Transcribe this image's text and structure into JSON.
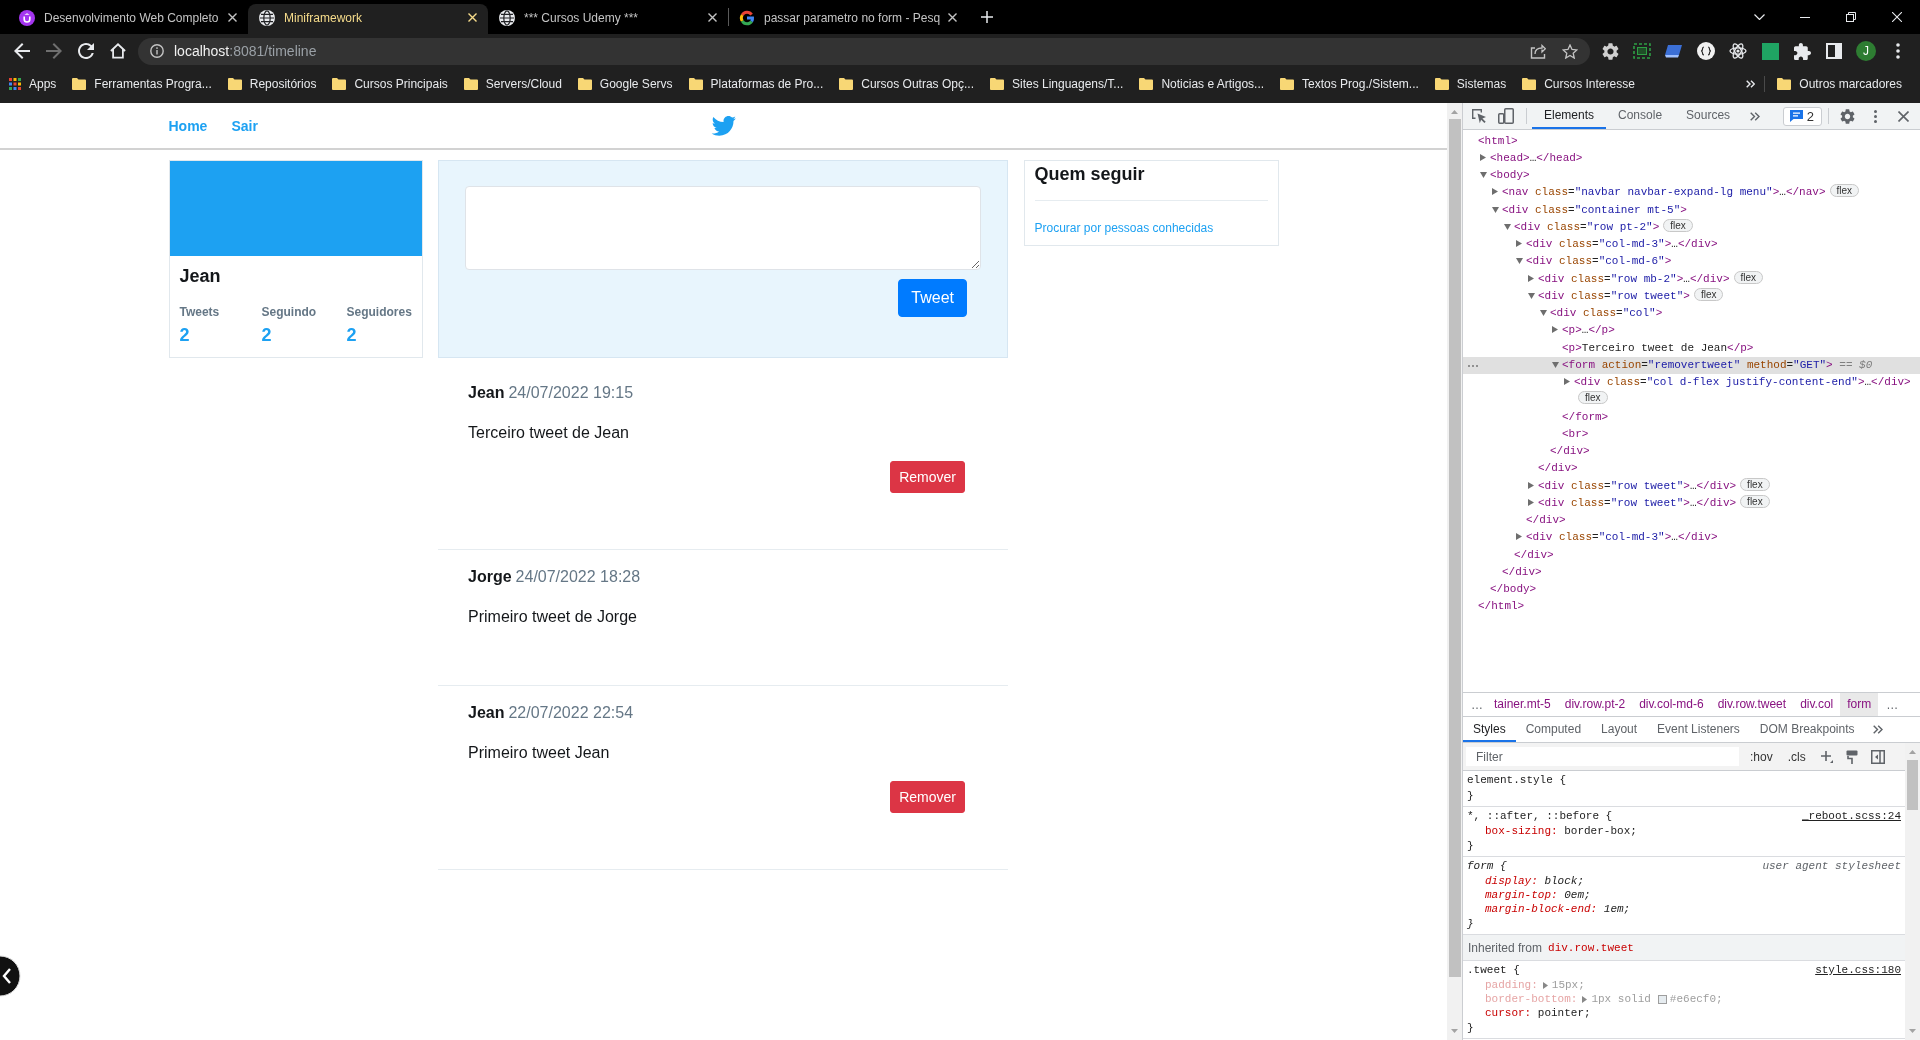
{
  "browser": {
    "tabs": [
      {
        "title": "Desenvolvimento Web Completo",
        "kind": "badge-logo",
        "selected": false
      },
      {
        "title": "Miniframework",
        "kind": "globe",
        "selected": true
      },
      {
        "title": "*** Cursos Udemy ***",
        "kind": "globe",
        "selected": false
      },
      {
        "title": "passar parametro no form - Pesq",
        "kind": "multicolor-g",
        "selected": false
      }
    ],
    "address": {
      "host": "localhost",
      "path": ":8081/timeline"
    },
    "profile_initial": "J",
    "bookmarks": [
      {
        "label": "Apps",
        "kind": "apps"
      },
      {
        "label": "Ferramentas Progra...",
        "kind": "folder"
      },
      {
        "label": "Repositórios",
        "kind": "folder"
      },
      {
        "label": "Cursos Principais",
        "kind": "folder"
      },
      {
        "label": "Servers/Cloud",
        "kind": "folder"
      },
      {
        "label": "Google Servs",
        "kind": "folder"
      },
      {
        "label": "Plataformas de Pro...",
        "kind": "folder"
      },
      {
        "label": "Cursos Outras Opç...",
        "kind": "folder"
      },
      {
        "label": "Sites Linguagens/T...",
        "kind": "folder"
      },
      {
        "label": "Noticias e Artigos...",
        "kind": "folder"
      },
      {
        "label": "Textos Prog./Sistem...",
        "kind": "folder"
      },
      {
        "label": "Sistemas",
        "kind": "folder"
      },
      {
        "label": "Cursos Interesse",
        "kind": "folder"
      }
    ],
    "other_bookmarks": {
      "label": "Outros marcadores"
    }
  },
  "page": {
    "nav_links": [
      {
        "label": "Home"
      },
      {
        "label": "Sair"
      }
    ],
    "profile": {
      "name": "Jean",
      "stats": [
        {
          "label": "Tweets",
          "value": "2"
        },
        {
          "label": "Seguindo",
          "value": "2"
        },
        {
          "label": "Seguidores",
          "value": "2"
        }
      ]
    },
    "composer": {
      "button": "Tweet"
    },
    "who_to_follow": {
      "title": "Quem seguir",
      "link": "Procurar por pessoas conhecidas"
    },
    "tweets": [
      {
        "author": "Jean",
        "date": "24/07/2022 19:15",
        "text": "Terceiro tweet de Jean",
        "remove_button": "Remover"
      },
      {
        "author": "Jorge",
        "date": "24/07/2022 18:28",
        "text": "Primeiro tweet de Jorge"
      },
      {
        "author": "Jean",
        "date": "22/07/2022 22:54",
        "text": "Primeiro tweet Jean",
        "remove_button": "Remover"
      }
    ]
  },
  "devtools": {
    "tabs": [
      {
        "label": "Elements",
        "selected": true
      },
      {
        "label": "Console",
        "selected": false
      },
      {
        "label": "Sources",
        "selected": false
      }
    ],
    "issues": "2",
    "dom_tree": {
      "line": "<html>",
      "selected": false,
      "children": [
        {
          "line": "<head>…</head>",
          "expanded": false,
          "selected": false
        },
        {
          "line": "<body>",
          "expanded": true,
          "selected": false,
          "children": [
            {
              "line": "<nav class=\"navbar navbar-expand-lg menu\">…</nav>",
              "expanded": false,
              "badge": "flex",
              "selected": false
            },
            {
              "line": "<div class=\"container mt-5\">",
              "expanded": true,
              "selected": false,
              "children": [
                {
                  "line": "<div class=\"row pt-2\">",
                  "expanded": true,
                  "badge": "flex",
                  "selected": false,
                  "children": [
                    {
                      "line": "<div class=\"col-md-3\">…</div>",
                      "expanded": false,
                      "selected": false
                    },
                    {
                      "line": "<div class=\"col-md-6\">",
                      "expanded": true,
                      "selected": false,
                      "children": [
                        {
                          "line": "<div class=\"row mb-2\">…</div>",
                          "expanded": false,
                          "badge": "flex",
                          "selected": false
                        },
                        {
                          "line": "<div class=\"row tweet\">",
                          "expanded": true,
                          "badge": "flex",
                          "selected": false,
                          "children": [
                            {
                              "line": "<div class=\"col\">",
                              "expanded": true,
                              "selected": false,
                              "children": [
                                {
                                  "line": "<p>…</p>",
                                  "expanded": false,
                                  "selected": false
                                },
                                {
                                  "line": "<p>Terceiro tweet de Jean</p>",
                                  "selected": false
                                },
                                {
                                  "line": "<form action=\"removertweet\" method=\"GET\">",
                                  "expanded": true,
                                  "selected": true,
                                  "suffix": "== $0",
                                  "children": [
                                    {
                                      "line": "<div class=\"col d-flex justify-content-end\">…</div>",
                                      "expanded": false,
                                      "badge": "flex",
                                      "selected": false
                                    }
                                  ],
                                  "end": "</form>"
                                },
                                {
                                  "line": "<br>",
                                  "selected": false
                                }
                              ],
                              "end": "</div>"
                            }
                          ],
                          "end": "</div>"
                        },
                        {
                          "line": "<div class=\"row tweet\">…</div>",
                          "expanded": false,
                          "badge": "flex",
                          "selected": false
                        },
                        {
                          "line": "<div class=\"row tweet\">…</div>",
                          "expanded": false,
                          "badge": "flex",
                          "selected": false
                        }
                      ],
                      "end": "</div>"
                    },
                    {
                      "line": "<div class=\"col-md-3\">…</div>",
                      "expanded": false,
                      "selected": false
                    }
                  ],
                  "end": "</div>"
                }
              ],
              "end": "</div>"
            }
          ],
          "end": "</body>"
        }
      ],
      "end": "</html>"
    },
    "breadcrumbs": {
      "before": "…",
      "items": [
        {
          "label": "tainer.mt-5",
          "selected": false
        },
        {
          "label": "div.row.pt-2",
          "selected": false
        },
        {
          "label": "div.col-md-6",
          "selected": false
        },
        {
          "label": "div.row.tweet",
          "selected": false
        },
        {
          "label": "div.col",
          "selected": false
        },
        {
          "label": "form",
          "selected": true
        }
      ],
      "after": "…"
    },
    "style_tabs": [
      {
        "label": "Styles",
        "selected": true
      },
      {
        "label": "Computed",
        "selected": false
      },
      {
        "label": "Layout",
        "selected": false
      },
      {
        "label": "Event Listeners",
        "selected": false
      },
      {
        "label": "DOM Breakpoints",
        "selected": false
      }
    ],
    "filter": {
      "placeholder": "Filter"
    },
    "filter_buttons": [
      ":hov",
      ".cls"
    ],
    "rules": [
      {
        "kind": "author",
        "selector": "element.style {",
        "close": "}"
      },
      {
        "kind": "author",
        "selector": "*, ::after, ::before {",
        "source": "_reboot.scss:24",
        "declarations": [
          {
            "name": "box-sizing:",
            "value": "border-box;",
            "expandable": false,
            "inactive": false
          }
        ],
        "close": "}"
      },
      {
        "kind": "user-agent",
        "selector": "form {",
        "source": "user agent stylesheet",
        "declarations": [
          {
            "name": "display:",
            "value": "block;",
            "expandable": false,
            "inactive": false
          },
          {
            "name": "margin-top:",
            "value": "0em;",
            "expandable": false,
            "inactive": false
          },
          {
            "name": "margin-block-end:",
            "value": "1em;",
            "expandable": false,
            "inactive": false
          }
        ],
        "close": "}"
      },
      {
        "kind": "inherited",
        "label": "Inherited from",
        "selector": "div.row.tweet"
      },
      {
        "kind": "author",
        "selector": ".tweet {",
        "source": "style.css:180",
        "declarations": [
          {
            "name": "padding:",
            "value": "15px;",
            "expandable": true,
            "inactive": true
          },
          {
            "name": "border-bottom:",
            "value": "1px solid",
            "expandable": true,
            "inactive": true,
            "swatch": {
              "color": "#e6ecf0",
              "text": "#e6ecf0;"
            }
          },
          {
            "name": "cursor:",
            "value": "pointer;",
            "expandable": false,
            "inactive": false
          }
        ],
        "close": "}"
      }
    ]
  }
}
